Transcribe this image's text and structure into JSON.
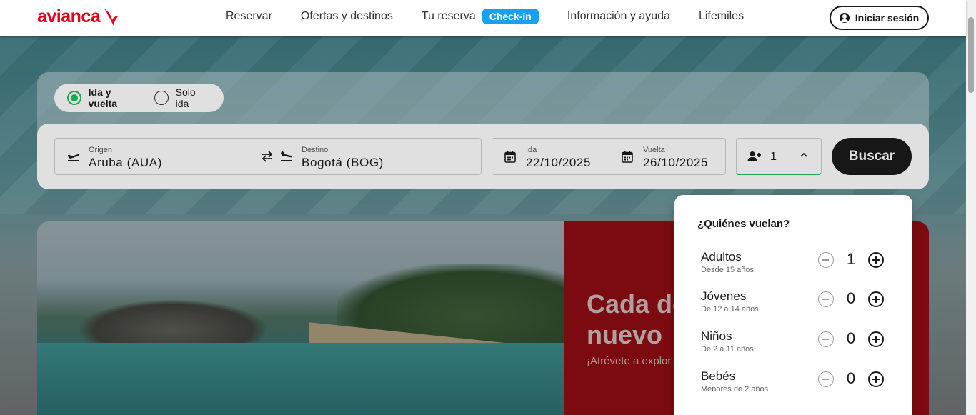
{
  "brand": {
    "name": "avianca",
    "color": "#e2001a"
  },
  "nav": {
    "items": [
      "Reservar",
      "Ofertas y destinos"
    ],
    "reserva_label": "Tu reserva",
    "checkin_label": "Check-in",
    "items_right": [
      "Información y ayuda",
      "Lifemiles"
    ],
    "login_label": "Iniciar sesión"
  },
  "search": {
    "trip_types": [
      {
        "label": "Ida y vuelta",
        "selected": true
      },
      {
        "label": "Solo ida",
        "selected": false
      }
    ],
    "origin": {
      "label": "Origen",
      "value": "Aruba (AUA)"
    },
    "destination": {
      "label": "Destino",
      "value": "Bogotá (BOG)"
    },
    "departure": {
      "label": "Ida",
      "value": "22/10/2025"
    },
    "return": {
      "label": "Vuelta",
      "value": "26/10/2025"
    },
    "passengers": "1",
    "search_label": "Buscar",
    "accent_color": "#1fbe5c"
  },
  "promo": {
    "title_line1": "Cada de",
    "title_line2": "nuevo",
    "subtitle": "¡Atrévete a explor"
  },
  "passengers_panel": {
    "title": "¿Quiénes vuelan?",
    "rows": [
      {
        "name": "Adultos",
        "range": "Desde 15 años",
        "count": "1"
      },
      {
        "name": "Jóvenes",
        "range": "De 12 a 14 años",
        "count": "0"
      },
      {
        "name": "Niños",
        "range": "De 2 a 11 años",
        "count": "0"
      },
      {
        "name": "Bebés",
        "range": "Menores de 2 años",
        "count": "0"
      }
    ]
  }
}
